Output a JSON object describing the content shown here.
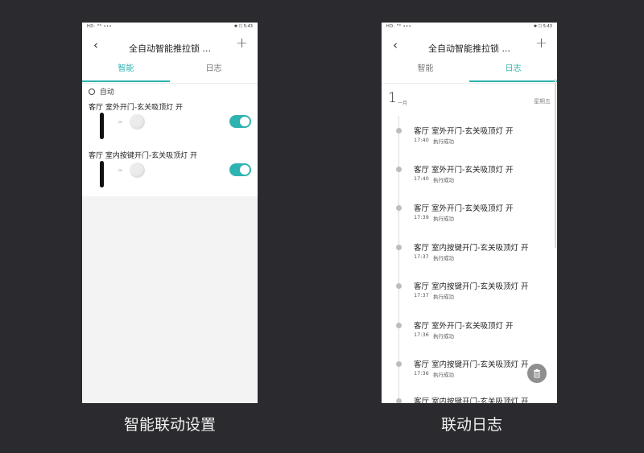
{
  "status_bar": {
    "left": "HD· ᴴᴰ •••",
    "right": "✱ ☐ 5:43"
  },
  "left_screen": {
    "title": "全自动智能推拉锁 ...",
    "tabs": [
      {
        "label": "智能",
        "active": true
      },
      {
        "label": "日志",
        "active": false
      }
    ],
    "section_label": "自动",
    "scenes": [
      {
        "name": "客厅 室外开门-玄关吸顶灯 开",
        "enabled": true
      },
      {
        "name": "客厅 室内按键开门-玄关吸顶灯 开",
        "enabled": true
      }
    ],
    "caption": "智能联动设置"
  },
  "right_screen": {
    "title": "全自动智能推拉锁 ...",
    "tabs": [
      {
        "label": "智能",
        "active": false
      },
      {
        "label": "日志",
        "active": true
      }
    ],
    "date": {
      "day": "1",
      "month": "一月",
      "weekday": "星期五"
    },
    "logs": [
      {
        "title": "客厅 室外开门-玄关吸顶灯 开",
        "time": "17:40",
        "status": "执行成功"
      },
      {
        "title": "客厅 室外开门-玄关吸顶灯 开",
        "time": "17:40",
        "status": "执行成功"
      },
      {
        "title": "客厅 室外开门-玄关吸顶灯 开",
        "time": "17:39",
        "status": "执行成功"
      },
      {
        "title": "客厅 室内按键开门-玄关吸顶灯 开",
        "time": "17:37",
        "status": "执行成功"
      },
      {
        "title": "客厅 室内按键开门-玄关吸顶灯 开",
        "time": "17:37",
        "status": "执行成功"
      },
      {
        "title": "客厅 室外开门-玄关吸顶灯 开",
        "time": "17:36",
        "status": "执行成功"
      },
      {
        "title": "客厅 室内按键开门-玄关吸顶灯 开",
        "time": "17:36",
        "status": "执行成功"
      },
      {
        "title": "客厅 室内按键开门-玄关吸顶灯 开",
        "time": "",
        "status": ""
      }
    ],
    "caption": "联动日志"
  },
  "icons": {
    "back": "chevron-left-icon",
    "add": "plus-icon",
    "auto": "robot-icon",
    "lock": "door-lock-icon",
    "link": "link-icon",
    "bulb": "ceiling-light-icon",
    "delete": "trash-icon"
  },
  "colors": {
    "accent": "#2fb3b1",
    "background": "#2b2b2f"
  }
}
